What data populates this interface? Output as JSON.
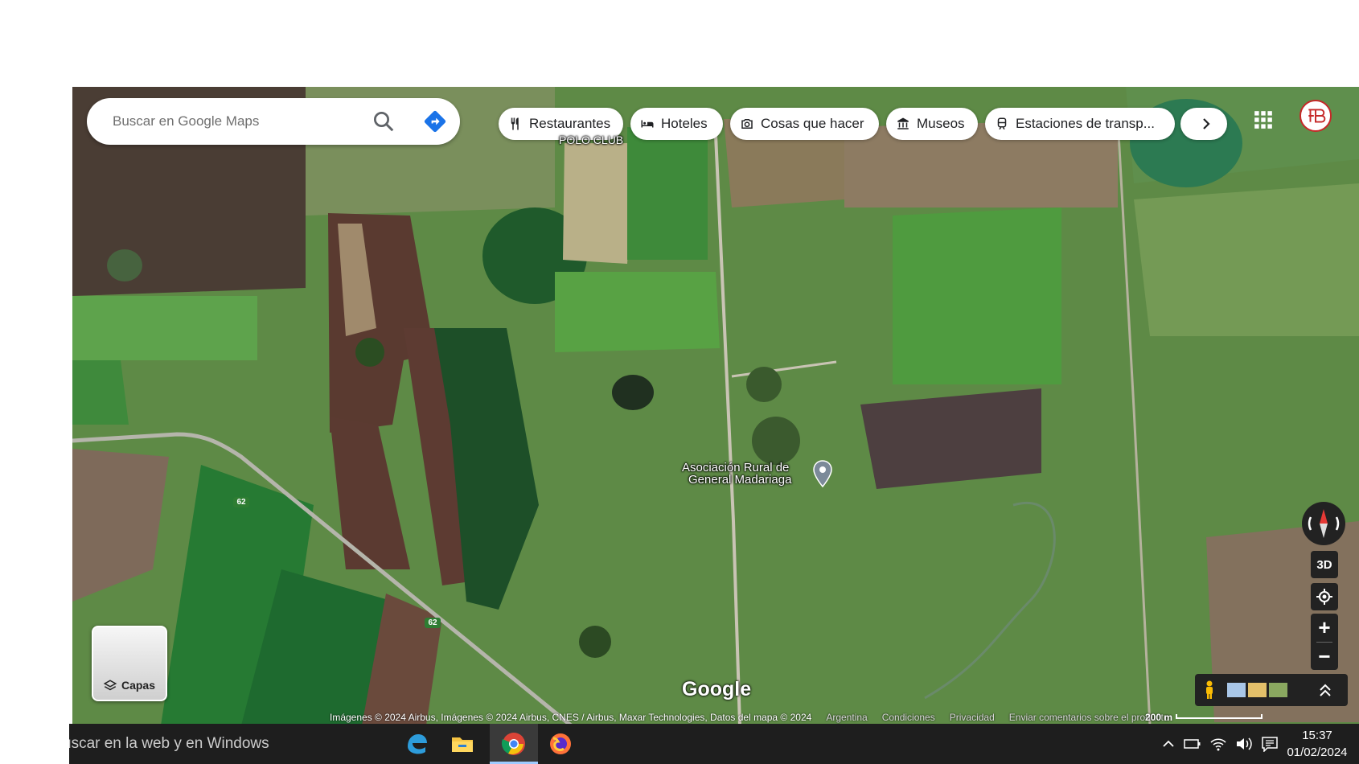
{
  "search": {
    "placeholder": "Buscar en Google Maps"
  },
  "categories": [
    {
      "label": "Restaurantes",
      "icon": "fork-knife-icon"
    },
    {
      "label": "Hoteles",
      "icon": "bed-icon"
    },
    {
      "label": "Cosas que hacer",
      "icon": "camera-icon"
    },
    {
      "label": "Museos",
      "icon": "museum-icon"
    },
    {
      "label": "Estaciones de transp...",
      "icon": "train-icon"
    }
  ],
  "map_labels": {
    "polo_club": "POLO CLUB",
    "poi_line1": "Asociación Rural de",
    "poi_line2": "General Madariaga",
    "route_number": "62"
  },
  "layers": {
    "label": "Capas"
  },
  "google_logo": "Google",
  "controls": {
    "three_d": "3D",
    "zoom_in": "+",
    "zoom_out": "−"
  },
  "attribution": {
    "imagery": "Imágenes © 2024 Airbus, Imágenes © 2024 Airbus, CNES / Airbus, Maxar Technologies, Datos del mapa © 2024",
    "country": "Argentina",
    "terms": "Condiciones",
    "privacy": "Privacidad",
    "feedback": "Enviar comentarios sobre el producto",
    "scale": "200 m"
  },
  "taskbar": {
    "search_text": "uscar en la web y en Windows",
    "time": "15:37",
    "date": "01/02/2024"
  },
  "colors": {
    "accent_blue": "#1a73e8",
    "avatar_red": "#c62828",
    "route_green": "#2e7d32"
  }
}
